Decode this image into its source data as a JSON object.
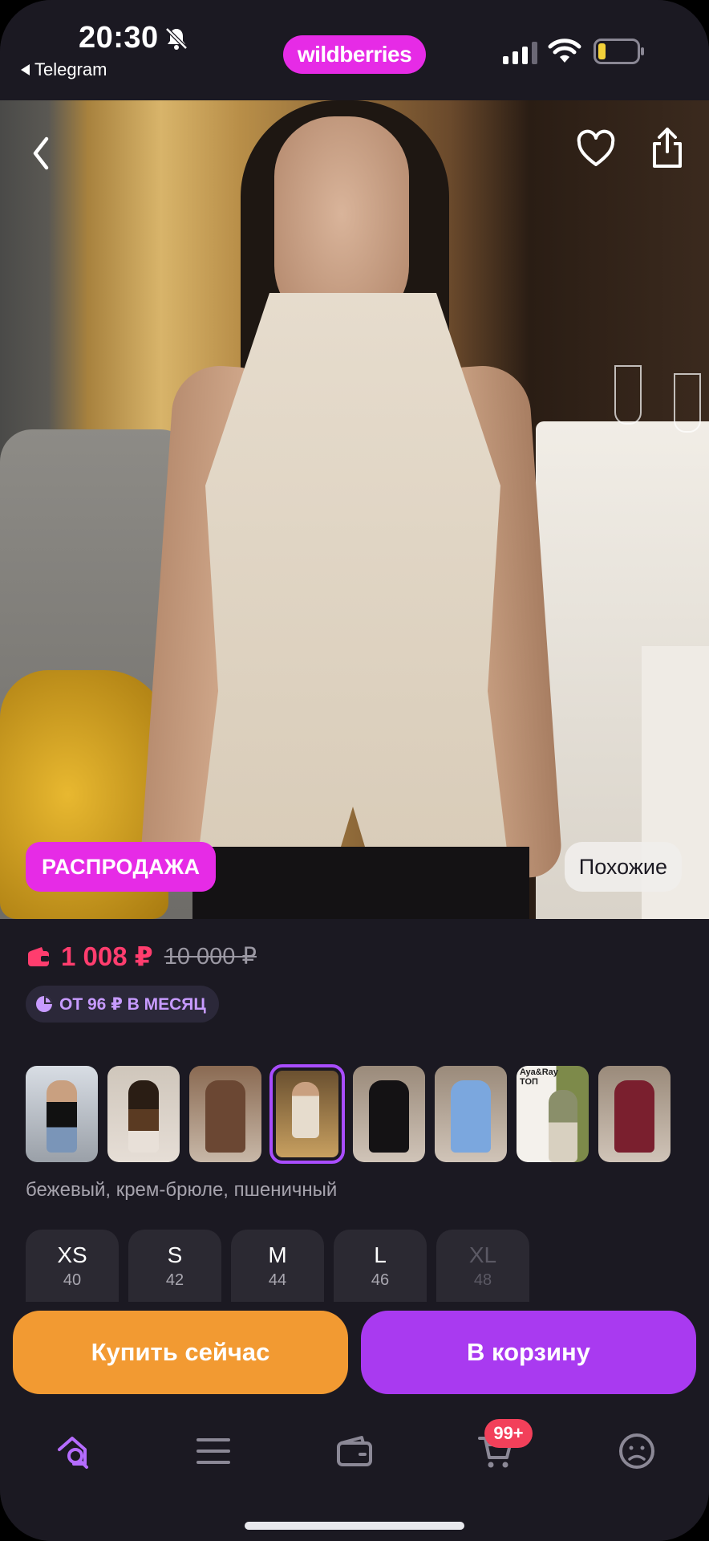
{
  "status": {
    "time": "20:30",
    "back_app": "Telegram",
    "brand": "wildberries",
    "icons": [
      "bell-off-icon",
      "signal-icon",
      "wifi-icon",
      "battery-icon"
    ]
  },
  "product": {
    "sale_badge": "РАСПРОДАЖА",
    "similar_label": "Похожие",
    "price": "1 008 ₽",
    "old_price": "10 000 ₽",
    "installment": "ОТ 96 ₽ В МЕСЯЦ",
    "color_name": "бежевый, крем-брюле, пшеничный",
    "thumb_texts": [
      "Aya&Ray",
      "ТОП"
    ],
    "sizes": [
      {
        "label": "XS",
        "ru": "40",
        "available": true
      },
      {
        "label": "S",
        "ru": "42",
        "available": true
      },
      {
        "label": "M",
        "ru": "44",
        "available": true
      },
      {
        "label": "L",
        "ru": "46",
        "available": true
      },
      {
        "label": "XL",
        "ru": "48",
        "available": false
      }
    ]
  },
  "actions": {
    "buy_now": "Купить сейчас",
    "add_to_cart": "В корзину"
  },
  "nav": {
    "cart_badge": "99+",
    "items": [
      "search-home-icon",
      "menu-icon",
      "wallet-icon",
      "cart-icon",
      "profile-icon"
    ]
  },
  "colors": {
    "accent_pink": "#e62be6",
    "accent_purple": "#a93af0",
    "buy_orange": "#f29a32",
    "price_red": "#ff3d6e",
    "background": "#1b1922"
  }
}
